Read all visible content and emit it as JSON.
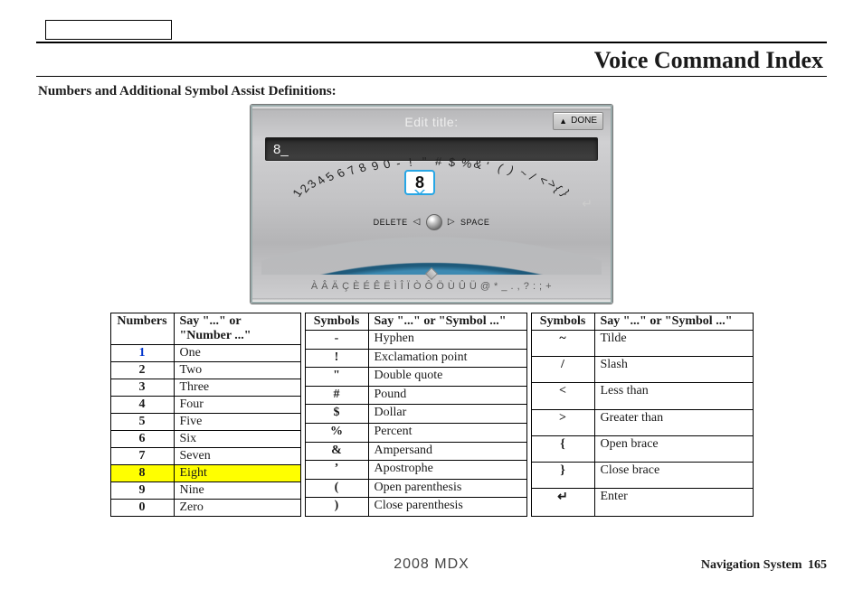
{
  "header": {
    "title": "Voice Command Index"
  },
  "section_heading": "Numbers and Additional Symbol Assist Definitions:",
  "screenshot": {
    "title_label": "Edit title:",
    "done_label": "DONE",
    "input_value": "8_",
    "bubble_char": "8",
    "arc_chars": [
      "1",
      "2",
      "3",
      "4",
      "5",
      "6",
      "7",
      "8",
      "9",
      "0",
      "-",
      "!",
      "\"",
      "#",
      "$",
      "%",
      "&",
      "'",
      "(",
      ")",
      "~",
      "/",
      "<",
      ">",
      "{",
      "}"
    ],
    "controls": {
      "delete": "DELETE",
      "space": "SPACE"
    },
    "bottom_strip": "À Â Ä Ç È É Ê Ë Ì Î Ï Ò Ô Ö Ù Û Ü @ * _   . , ? : ; +"
  },
  "tables": {
    "numbers": {
      "headers": [
        "Numbers",
        "Say \"...\" or \"Number ...\""
      ],
      "rows": [
        {
          "n": "1",
          "say": "One",
          "first": true
        },
        {
          "n": "2",
          "say": "Two"
        },
        {
          "n": "3",
          "say": "Three"
        },
        {
          "n": "4",
          "say": "Four"
        },
        {
          "n": "5",
          "say": "Five"
        },
        {
          "n": "6",
          "say": "Six"
        },
        {
          "n": "7",
          "say": "Seven"
        },
        {
          "n": "8",
          "say": "Eight",
          "highlight": true
        },
        {
          "n": "9",
          "say": "Nine"
        },
        {
          "n": "0",
          "say": "Zero"
        }
      ]
    },
    "symbols1": {
      "headers": [
        "Symbols",
        "Say \"...\" or \"Symbol ...\""
      ],
      "rows": [
        {
          "s": "-",
          "say": "Hyphen"
        },
        {
          "s": "!",
          "say": "Exclamation point"
        },
        {
          "s": "\"",
          "say": "Double quote"
        },
        {
          "s": "#",
          "say": "Pound"
        },
        {
          "s": "$",
          "say": "Dollar"
        },
        {
          "s": "%",
          "say": "Percent"
        },
        {
          "s": "&",
          "say": "Ampersand"
        },
        {
          "s": "’",
          "say": "Apostrophe"
        },
        {
          "s": "(",
          "say": "Open parenthesis"
        },
        {
          "s": ")",
          "say": "Close parenthesis"
        }
      ]
    },
    "symbols2": {
      "headers": [
        "Symbols",
        "Say \"...\" or \"Symbol ...\""
      ],
      "rows": [
        {
          "s": "~",
          "say": "Tilde"
        },
        {
          "s": "/",
          "say": "Slash"
        },
        {
          "s": "<",
          "say": "Less than"
        },
        {
          "s": ">",
          "say": "Greater than"
        },
        {
          "s": "{",
          "say": "Open brace"
        },
        {
          "s": "}",
          "say": "Close brace"
        },
        {
          "s": "enter-icon",
          "say": "Enter",
          "icon": true
        }
      ]
    }
  },
  "footer": {
    "model": "2008  MDX",
    "nav_label": "Navigation System",
    "page_number": "165"
  }
}
